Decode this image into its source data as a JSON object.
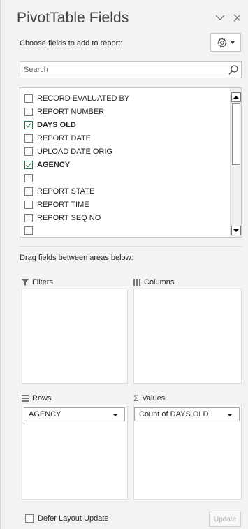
{
  "header": {
    "title": "PivotTable Fields",
    "subtitle": "Choose fields to add to report:",
    "chevron_icon": "chevron-down-icon",
    "close_icon": "close-icon",
    "tools_icon": "gear-icon"
  },
  "search": {
    "placeholder": "Search",
    "value": ""
  },
  "fields": [
    {
      "label": "RECORD EVALUATED BY",
      "checked": false
    },
    {
      "label": "REPORT NUMBER",
      "checked": false
    },
    {
      "label": "DAYS OLD",
      "checked": true
    },
    {
      "label": "REPORT DATE",
      "checked": false
    },
    {
      "label": "UPLOAD DATE ORIG",
      "checked": false
    },
    {
      "label": "AGENCY",
      "checked": true
    },
    {
      "label": "",
      "checked": false
    },
    {
      "label": "REPORT STATE",
      "checked": false
    },
    {
      "label": "REPORT TIME",
      "checked": false
    },
    {
      "label": "REPORT SEQ NO",
      "checked": false
    }
  ],
  "areas": {
    "drag_label": "Drag fields between areas below:",
    "filters": {
      "label": "Filters",
      "items": []
    },
    "columns": {
      "label": "Columns",
      "items": []
    },
    "rows": {
      "label": "Rows",
      "items": [
        "AGENCY"
      ]
    },
    "values": {
      "label": "Values",
      "items": [
        "Count of DAYS OLD"
      ]
    }
  },
  "footer": {
    "defer_label": "Defer Layout Update",
    "defer_checked": false,
    "update_label": "Update"
  },
  "colors": {
    "accent": "#217346",
    "panel_bg": "#f3f3f3"
  }
}
